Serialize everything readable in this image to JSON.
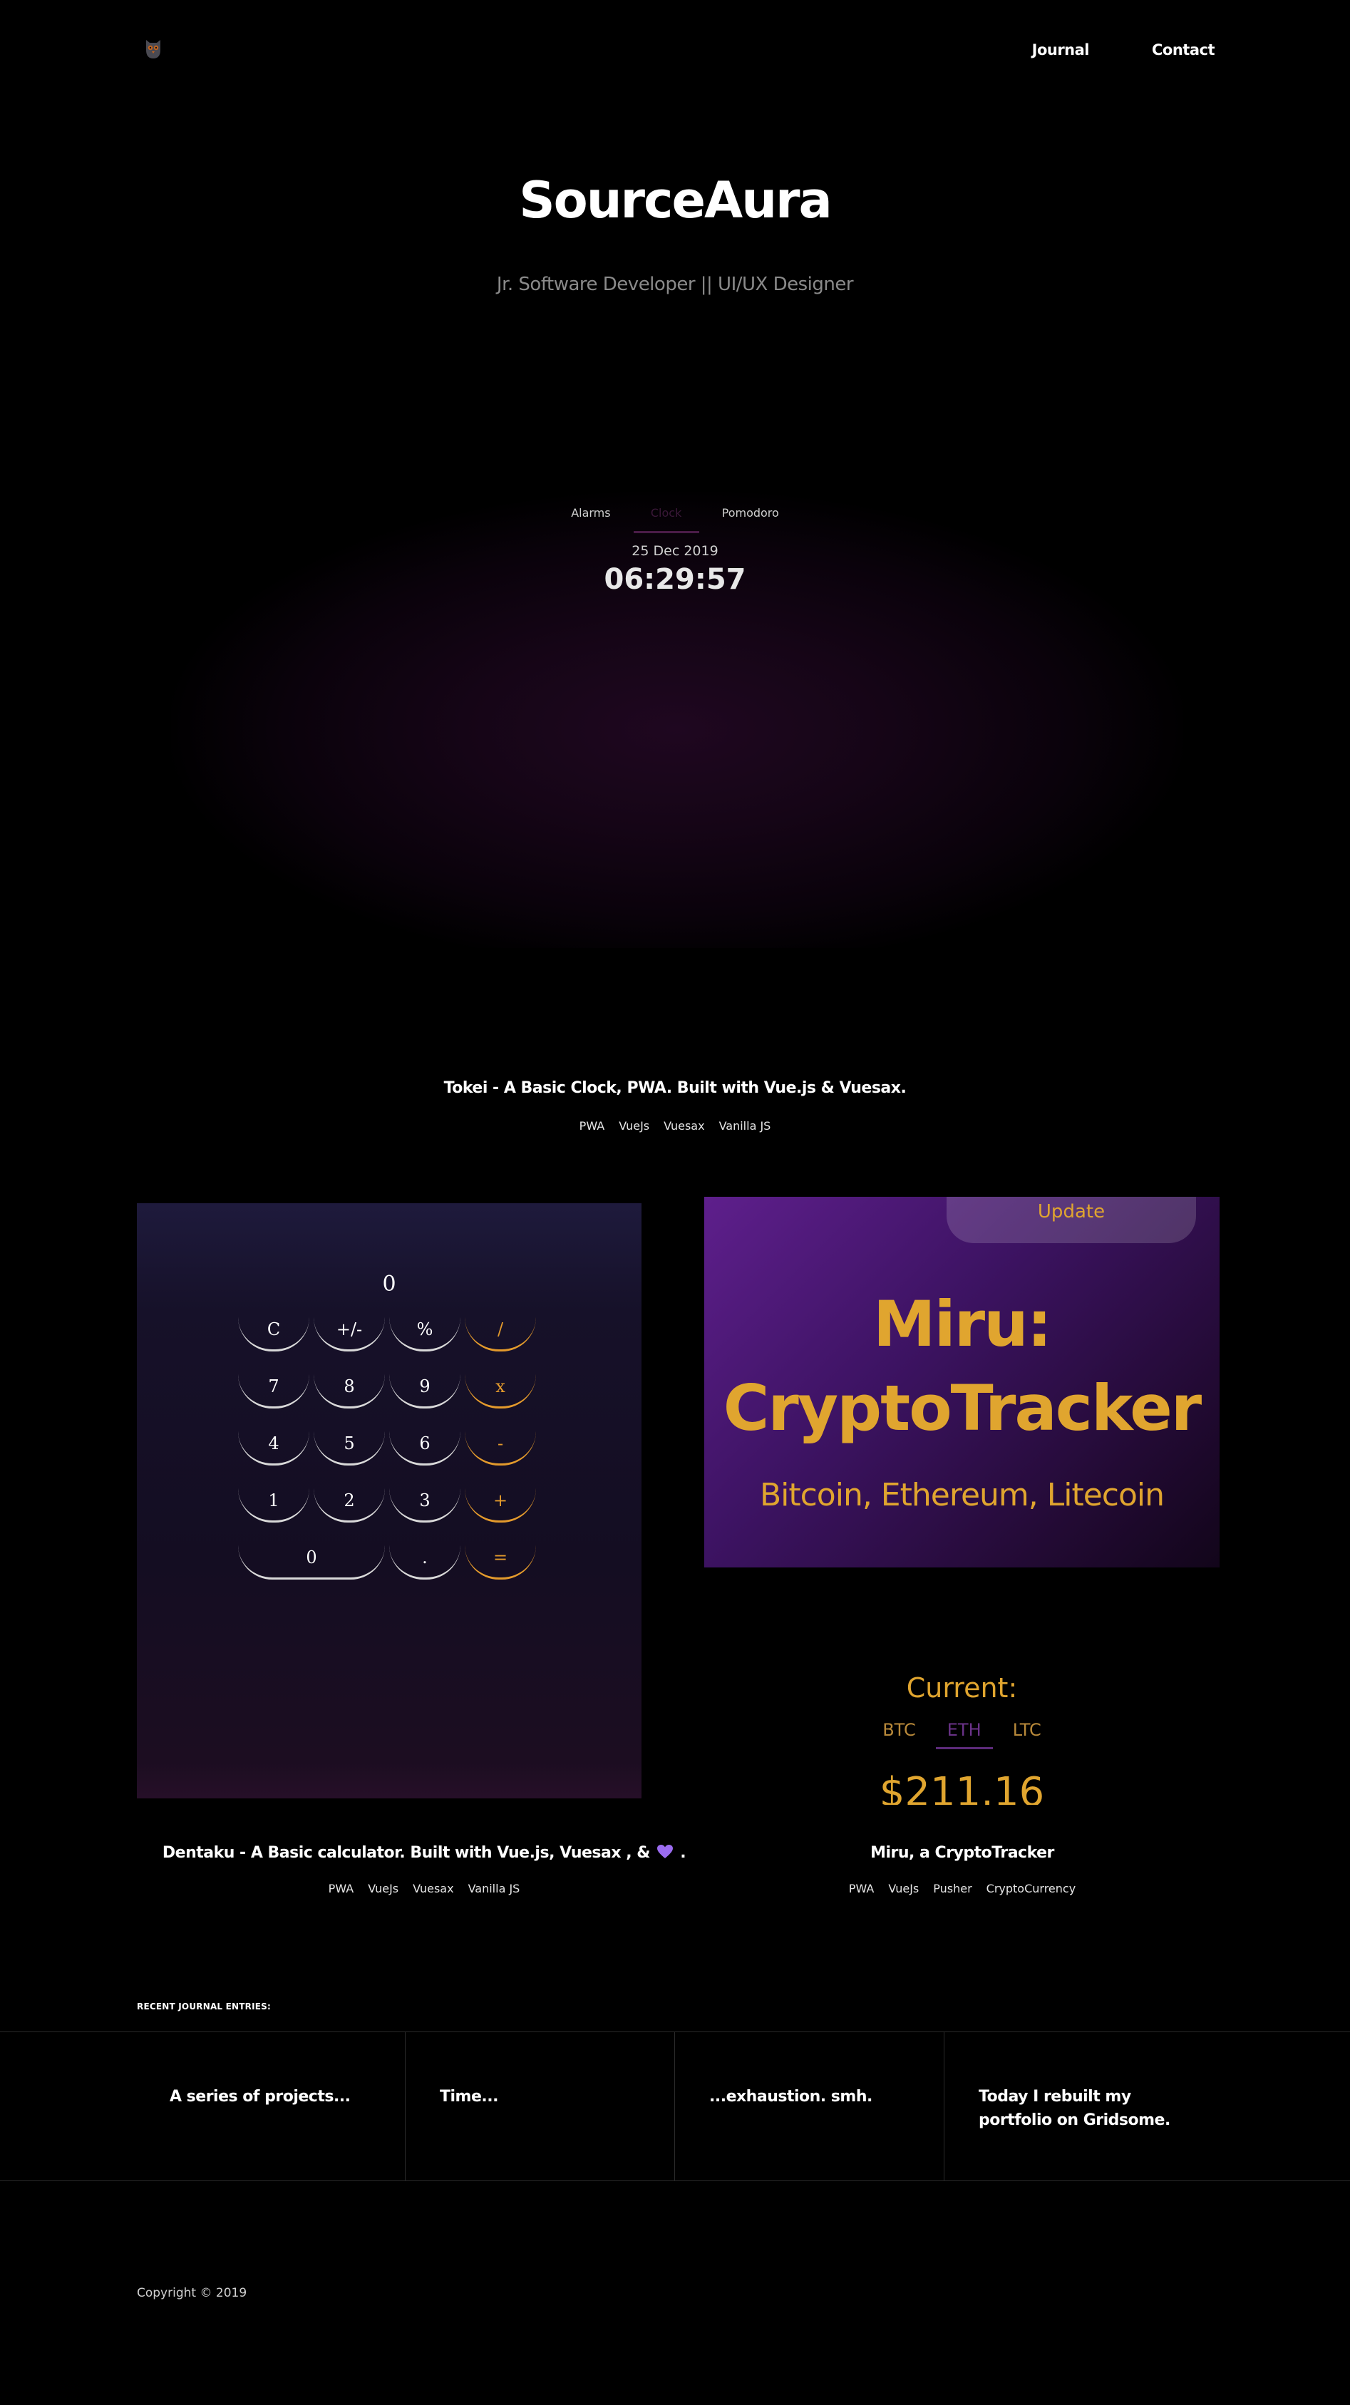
{
  "header": {
    "logo_icon": "owl-icon",
    "nav": [
      {
        "label": "Journal"
      },
      {
        "label": "Contact"
      }
    ]
  },
  "hero": {
    "title": "SourceAura",
    "subtitle": "Jr. Software Developer || UI/UX Designer"
  },
  "tokei": {
    "tabs": [
      "Alarms",
      "Clock",
      "Pomodoro"
    ],
    "active_tab": "Clock",
    "date": "25 Dec 2019",
    "time": "06:29:57",
    "title": "Tokei - A Basic Clock, PWA. Built with Vue.js & Vuesax.",
    "tags": [
      "PWA",
      "VueJs",
      "Vuesax",
      "Vanilla JS"
    ]
  },
  "dentaku": {
    "display": "0",
    "buttons": [
      {
        "label": "C",
        "op": false
      },
      {
        "label": "+/-",
        "op": false
      },
      {
        "label": "%",
        "op": false
      },
      {
        "label": "/",
        "op": true
      },
      {
        "label": "7",
        "op": false
      },
      {
        "label": "8",
        "op": false
      },
      {
        "label": "9",
        "op": false
      },
      {
        "label": "x",
        "op": true
      },
      {
        "label": "4",
        "op": false
      },
      {
        "label": "5",
        "op": false
      },
      {
        "label": "6",
        "op": false
      },
      {
        "label": "-",
        "op": true
      },
      {
        "label": "1",
        "op": false
      },
      {
        "label": "2",
        "op": false
      },
      {
        "label": "3",
        "op": false
      },
      {
        "label": "+",
        "op": true
      },
      {
        "label": "0",
        "op": false,
        "wide": true
      },
      {
        "label": ".",
        "op": false
      },
      {
        "label": "=",
        "op": true
      }
    ],
    "title": "Dentaku - A Basic calculator. Built with Vue.js, Vuesax , &",
    "title_end": ".",
    "heart_icon": "purple-heart-icon",
    "tags": [
      "PWA",
      "VueJs",
      "Vuesax",
      "Vanilla JS"
    ]
  },
  "miru": {
    "update_label": "Update",
    "banner_title_line1": "Miru:",
    "banner_title_line2": "CryptoTracker",
    "banner_subtitle": "Bitcoin, Ethereum, Litecoin",
    "current_label": "Current:",
    "coins": [
      "BTC",
      "ETH",
      "LTC"
    ],
    "active_coin": "ETH",
    "price": "$211.16",
    "title": "Miru, a CryptoTracker",
    "tags": [
      "PWA",
      "VueJs",
      "Pusher",
      "CryptoCurrency"
    ]
  },
  "journal": {
    "label": "RECENT JOURNAL ENTRIES:",
    "entries": [
      "A series of projects...",
      "Time...",
      "...exhaustion. smh.",
      "Today I rebuilt my portfolio on Gridsome."
    ]
  },
  "footer": {
    "copyright": "Copyright © 2019"
  },
  "colors": {
    "background": "#000000",
    "accent_gold": "#e0a52f",
    "accent_purple": "#5e1f8c",
    "calc_op": "#e39a2c"
  }
}
